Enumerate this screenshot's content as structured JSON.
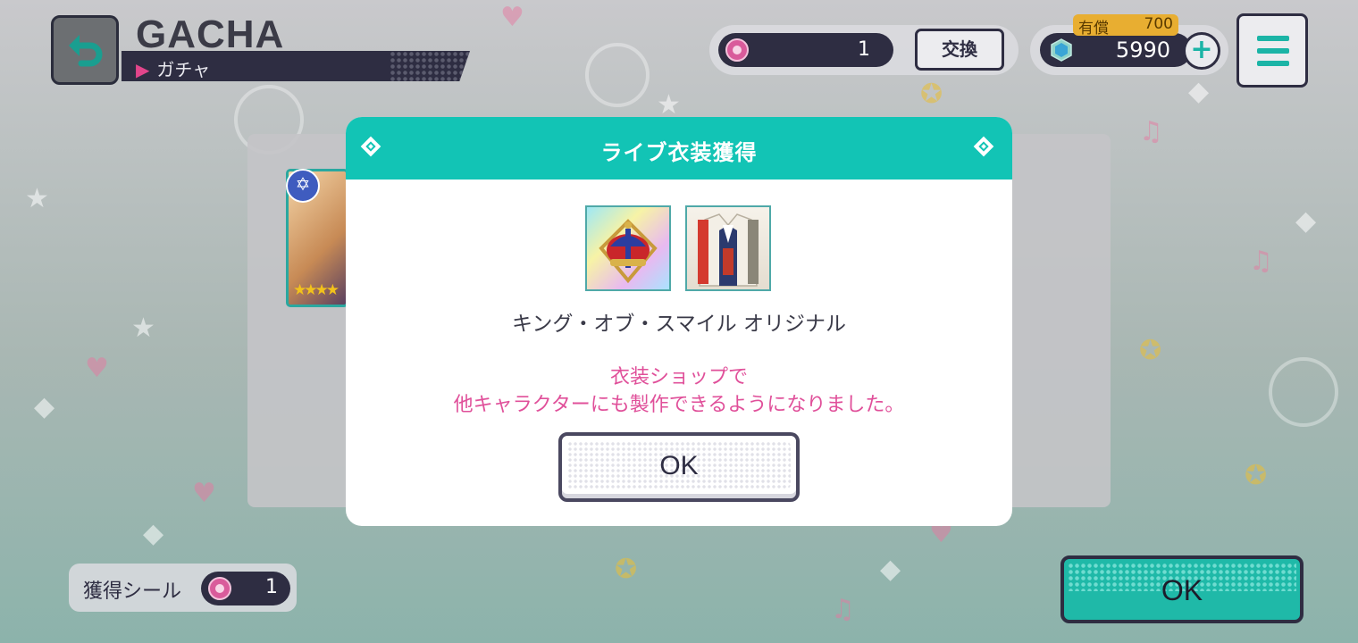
{
  "header": {
    "title": "GACHA",
    "subtitle": "ガチャ"
  },
  "resources": {
    "seal_count": "1",
    "exchange_label": "交換",
    "paid_label": "有償",
    "paid_amount": "700",
    "gem_amount": "5990"
  },
  "modal": {
    "title": "ライブ衣装獲得",
    "item_name": "キング・オブ・スマイル オリジナル",
    "notice_line1": "衣装ショップで",
    "notice_line2": "他キャラクターにも製作できるようになりました。",
    "ok_label": "OK",
    "items": [
      {
        "icon": "crown-icon"
      },
      {
        "icon": "costume-icon"
      }
    ]
  },
  "footer": {
    "seal_label": "獲得シール",
    "seal_count": "1",
    "ok_label": "OK"
  },
  "colors": {
    "accent": "#12c4b5",
    "notice": "#e0509a",
    "dark": "#2e2d42"
  }
}
